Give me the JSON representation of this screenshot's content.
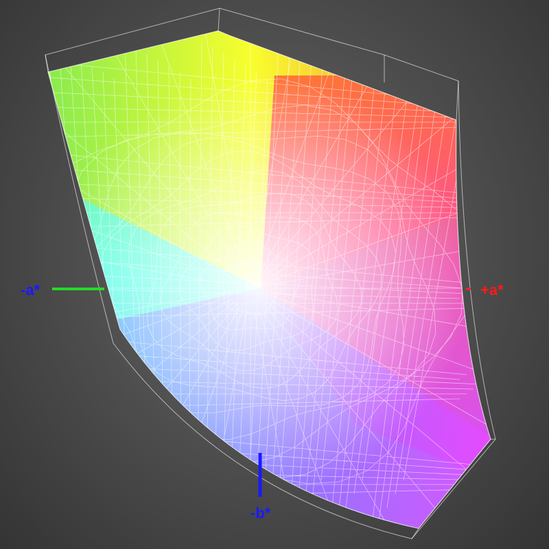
{
  "axes": {
    "neg_a": {
      "label": "-a*",
      "color": "#1a1aff"
    },
    "pos_a": {
      "label": "+a*",
      "color": "#ff1a1a"
    },
    "neg_b": {
      "label": "-b*",
      "color": "#1a1aff"
    },
    "neg_a_line_color": "#22dd22",
    "pos_a_line_color": "#ff2020",
    "neg_b_line_color": "#1a1aff"
  },
  "colors": {
    "background": "#4b4b4b",
    "wireframe": "#ffffff",
    "gamut_stops": [
      "#6fe64a",
      "#ffff28",
      "#ff7a3a",
      "#ff3bff",
      "#7e62ff",
      "#5fb6ff",
      "#59ffff"
    ]
  }
}
